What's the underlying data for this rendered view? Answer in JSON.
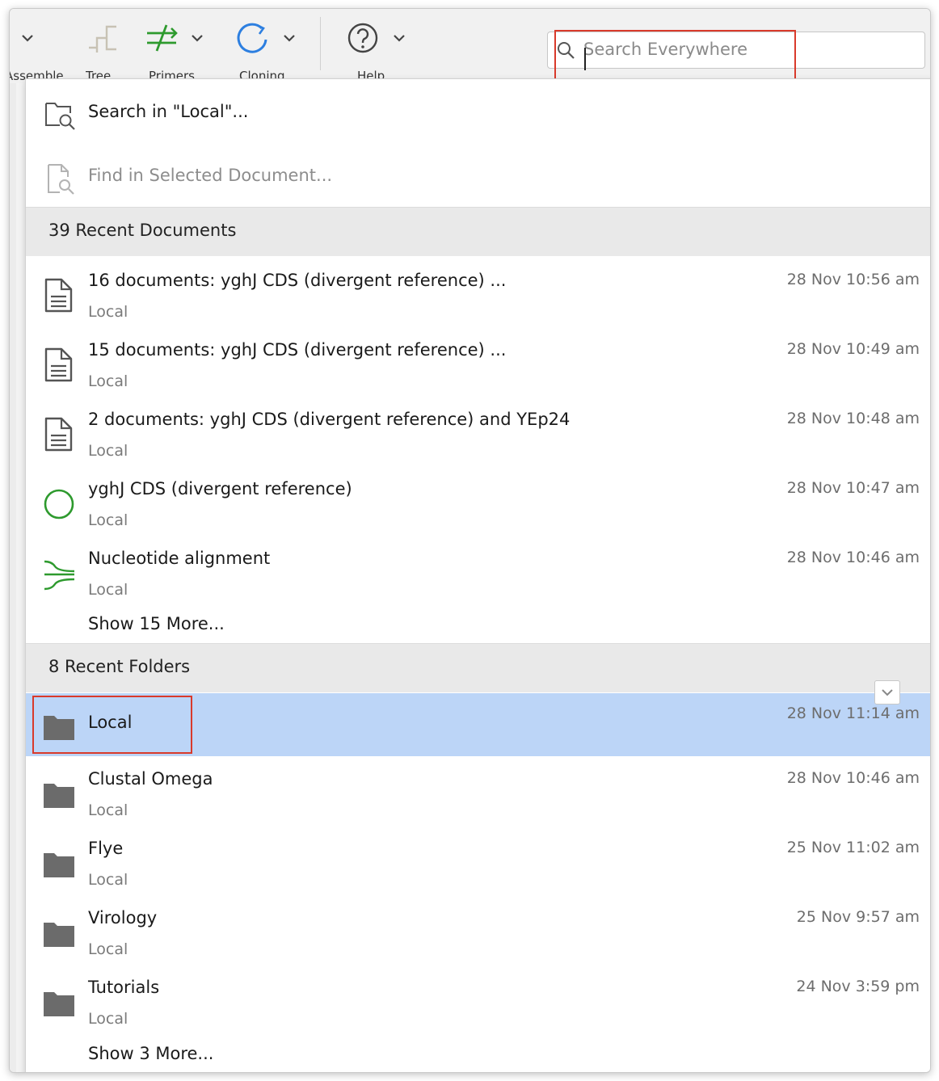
{
  "toolbar": {
    "buttons": [
      {
        "name": "assemble",
        "label": "Assemble",
        "icon": "assemble-icon"
      },
      {
        "name": "tree",
        "label": "Tree",
        "icon": "tree-icon"
      },
      {
        "name": "primers",
        "label": "Primers",
        "icon": "primers-icon"
      },
      {
        "name": "cloning",
        "label": "Cloning",
        "icon": "cloning-icon"
      },
      {
        "name": "help",
        "label": "Help",
        "icon": "help-icon"
      }
    ],
    "colors": {
      "primers": "#2e9a2e",
      "cloning": "#2d7fe0",
      "tree": "#c8c2b4",
      "help": "#444444"
    }
  },
  "search": {
    "placeholder": "Search Everywhere",
    "value": ""
  },
  "actions": [
    {
      "label": "Search in \"Local\"...",
      "icon": "folder-search-icon",
      "enabled": true
    },
    {
      "label": "Find in Selected Document...",
      "icon": "document-search-icon",
      "enabled": false
    }
  ],
  "recent_documents": {
    "header": "39 Recent Documents",
    "items": [
      {
        "title": "16 documents: yghJ CDS (divergent reference) ...",
        "location": "Local",
        "date": "28 Nov 10:56 am",
        "icon": "document-icon"
      },
      {
        "title": "15 documents: yghJ CDS (divergent reference) ...",
        "location": "Local",
        "date": "28 Nov 10:49 am",
        "icon": "document-icon"
      },
      {
        "title": "2 documents: yghJ CDS (divergent reference) and YEp24",
        "location": "Local",
        "date": "28 Nov 10:48 am",
        "icon": "document-icon"
      },
      {
        "title": "yghJ CDS (divergent reference)",
        "location": "Local",
        "date": "28 Nov 10:47 am",
        "icon": "circular-sequence-icon"
      },
      {
        "title": "Nucleotide alignment",
        "location": "Local",
        "date": "28 Nov 10:46 am",
        "icon": "alignment-icon"
      }
    ],
    "show_more": "Show 15 More..."
  },
  "recent_folders": {
    "header": "8 Recent Folders",
    "items": [
      {
        "title": "Local",
        "location": "",
        "date": "28 Nov 11:14 am",
        "icon": "folder-icon",
        "selected": true
      },
      {
        "title": "Clustal Omega",
        "location": "Local",
        "date": "28 Nov 10:46 am",
        "icon": "folder-icon"
      },
      {
        "title": "Flye",
        "location": "Local",
        "date": "25 Nov 11:02 am",
        "icon": "folder-icon"
      },
      {
        "title": "Virology",
        "location": "Local",
        "date": "25 Nov 9:57 am",
        "icon": "folder-icon"
      },
      {
        "title": "Tutorials",
        "location": "Local",
        "date": "24 Nov 3:59 pm",
        "icon": "folder-icon"
      }
    ],
    "show_more": "Show 3 More..."
  },
  "colors": {
    "selection": "#bcd5f7",
    "annotation_highlight": "#d93a2b",
    "section_header_bg": "#e9e9e9",
    "folder": "#6b6b6b",
    "sequence_green": "#2e9a2e"
  }
}
